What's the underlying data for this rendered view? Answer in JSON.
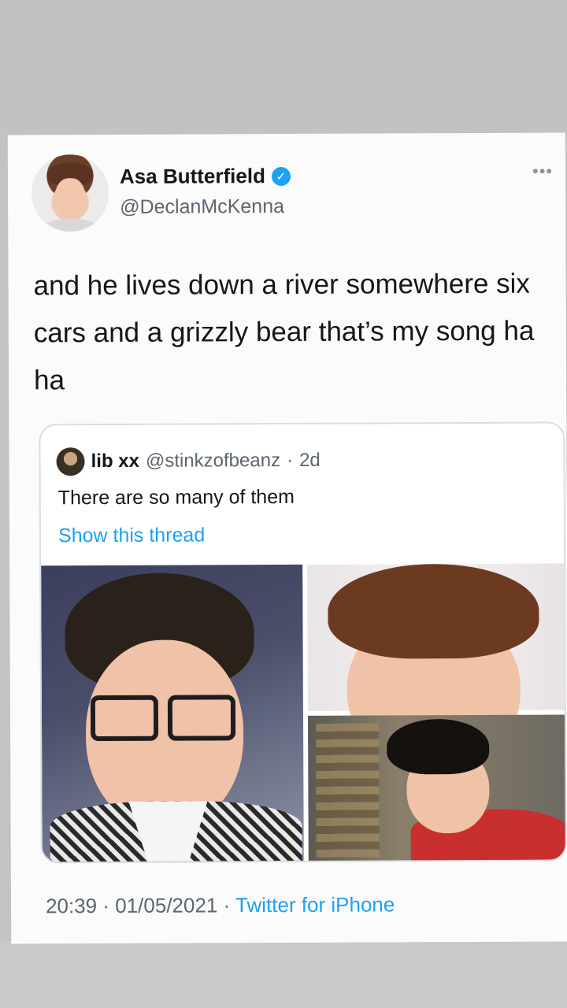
{
  "tweet": {
    "author_name": "Asa Butterfield",
    "author_handle": "@DeclanMcKenna",
    "verified_mark": "✓",
    "more_glyph": "•••",
    "text": "and he lives down a river somewhere six cars and a grizzly bear that’s my song ha ha",
    "time": "20:39",
    "date": "01/05/2021",
    "source": "Twitter for iPhone",
    "separator": " · "
  },
  "quoted": {
    "author_name": "lib xx",
    "author_handle": "@stinkzofbeanz",
    "age": "2d",
    "separator": "·",
    "text": "There are so many of them",
    "show_thread": "Show this thread"
  },
  "colors": {
    "link": "#1da1f2",
    "text": "#14171a",
    "secondary": "#5b6670"
  }
}
